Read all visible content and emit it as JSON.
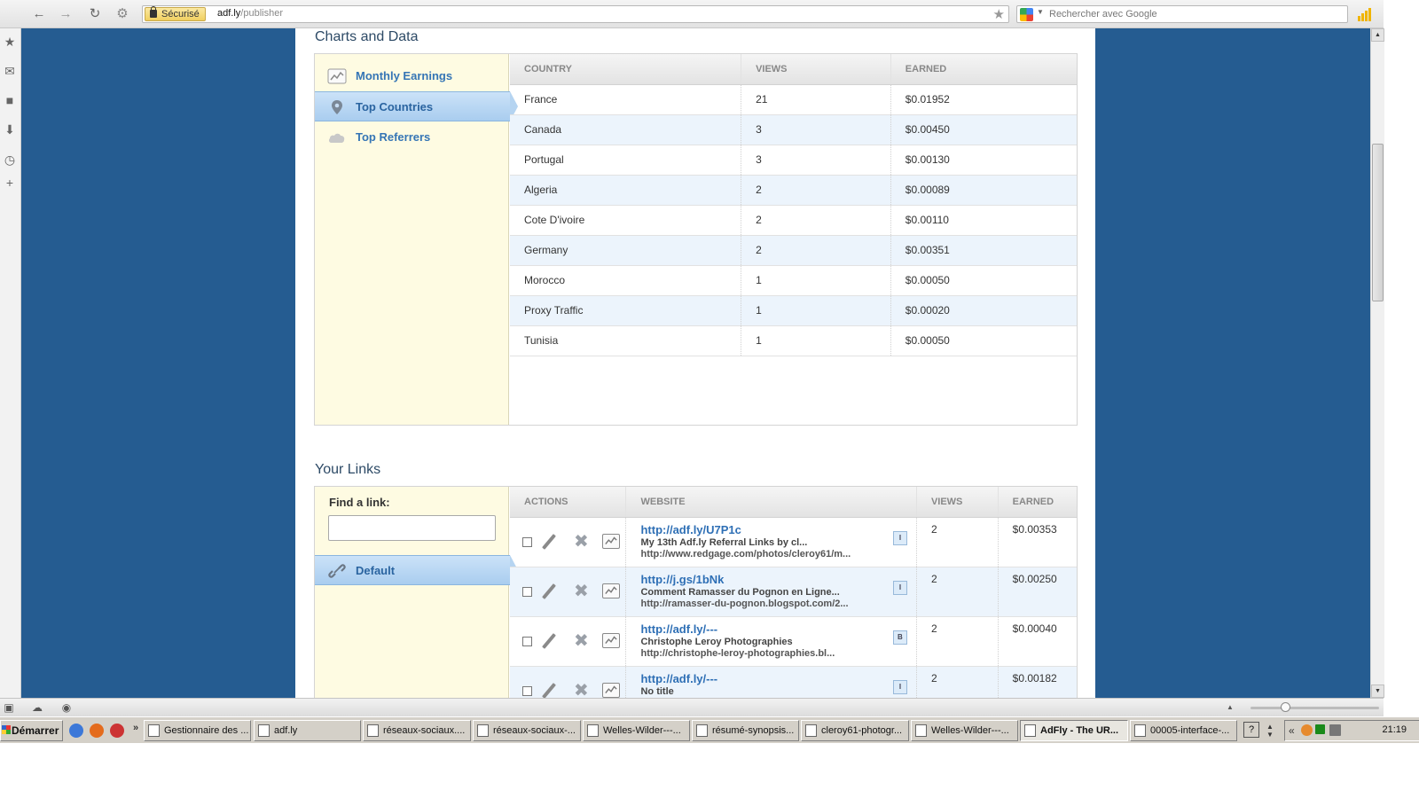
{
  "browser": {
    "secure_label": "Sécurisé",
    "url_host": "adf.ly",
    "url_path": "/publisher",
    "search_placeholder": "Rechercher avec Google"
  },
  "charts": {
    "section_title": "Charts and Data",
    "nav": [
      {
        "label": "Monthly Earnings",
        "active": false
      },
      {
        "label": "Top Countries",
        "active": true
      },
      {
        "label": "Top Referrers",
        "active": false
      }
    ],
    "headers": [
      "COUNTRY",
      "VIEWS",
      "EARNED"
    ],
    "rows": [
      {
        "country": "France",
        "views": "21",
        "earned": "$0.01952"
      },
      {
        "country": "Canada",
        "views": "3",
        "earned": "$0.00450"
      },
      {
        "country": "Portugal",
        "views": "3",
        "earned": "$0.00130"
      },
      {
        "country": "Algeria",
        "views": "2",
        "earned": "$0.00089"
      },
      {
        "country": "Cote D'ivoire",
        "views": "2",
        "earned": "$0.00110"
      },
      {
        "country": "Germany",
        "views": "2",
        "earned": "$0.00351"
      },
      {
        "country": "Morocco",
        "views": "1",
        "earned": "$0.00050"
      },
      {
        "country": "Proxy Traffic",
        "views": "1",
        "earned": "$0.00020"
      },
      {
        "country": "Tunisia",
        "views": "1",
        "earned": "$0.00050"
      }
    ]
  },
  "links": {
    "section_title": "Your Links",
    "find_label": "Find a link:",
    "find_value": "",
    "group": "Default",
    "headers": [
      "ACTIONS",
      "WEBSITE",
      "VIEWS",
      "EARNED"
    ],
    "rows": [
      {
        "short": "http://adf.ly/U7P1c",
        "title": "My 13th Adf.ly Referral Links by cl...",
        "url": "http://www.redgage.com/photos/cleroy61/m...",
        "badge": "I",
        "views": "2",
        "earned": "$0.00353"
      },
      {
        "short": "http://j.gs/1bNk",
        "title": "Comment Ramasser du Pognon en Ligne...",
        "url": "http://ramasser-du-pognon.blogspot.com/2...",
        "badge": "I",
        "views": "2",
        "earned": "$0.00250"
      },
      {
        "short": "http://adf.ly/---",
        "title": "Christophe Leroy Photographies",
        "url": "http://christophe-leroy-photographies.bl...",
        "badge": "B",
        "views": "2",
        "earned": "$0.00040"
      },
      {
        "short": "http://adf.ly/---",
        "title": "No title",
        "url": "",
        "badge": "I",
        "views": "2",
        "earned": "$0.00182"
      }
    ]
  },
  "taskbar": {
    "start": "Démarrer",
    "tasks": [
      {
        "label": "Gestionnaire des ...",
        "active": false
      },
      {
        "label": "adf.ly",
        "active": false
      },
      {
        "label": "réseaux-sociaux....",
        "active": false
      },
      {
        "label": "réseaux-sociaux-...",
        "active": false
      },
      {
        "label": "Welles-Wilder---...",
        "active": false
      },
      {
        "label": "résumé-synopsis...",
        "active": false
      },
      {
        "label": "cleroy61-photogr...",
        "active": false
      },
      {
        "label": "Welles-Wilder---...",
        "active": false
      },
      {
        "label": "AdFly - The UR...",
        "active": true
      },
      {
        "label": "00005-interface-...",
        "active": false
      }
    ],
    "clock": "21:19",
    "tray_chevron": "«",
    "help": "?"
  }
}
